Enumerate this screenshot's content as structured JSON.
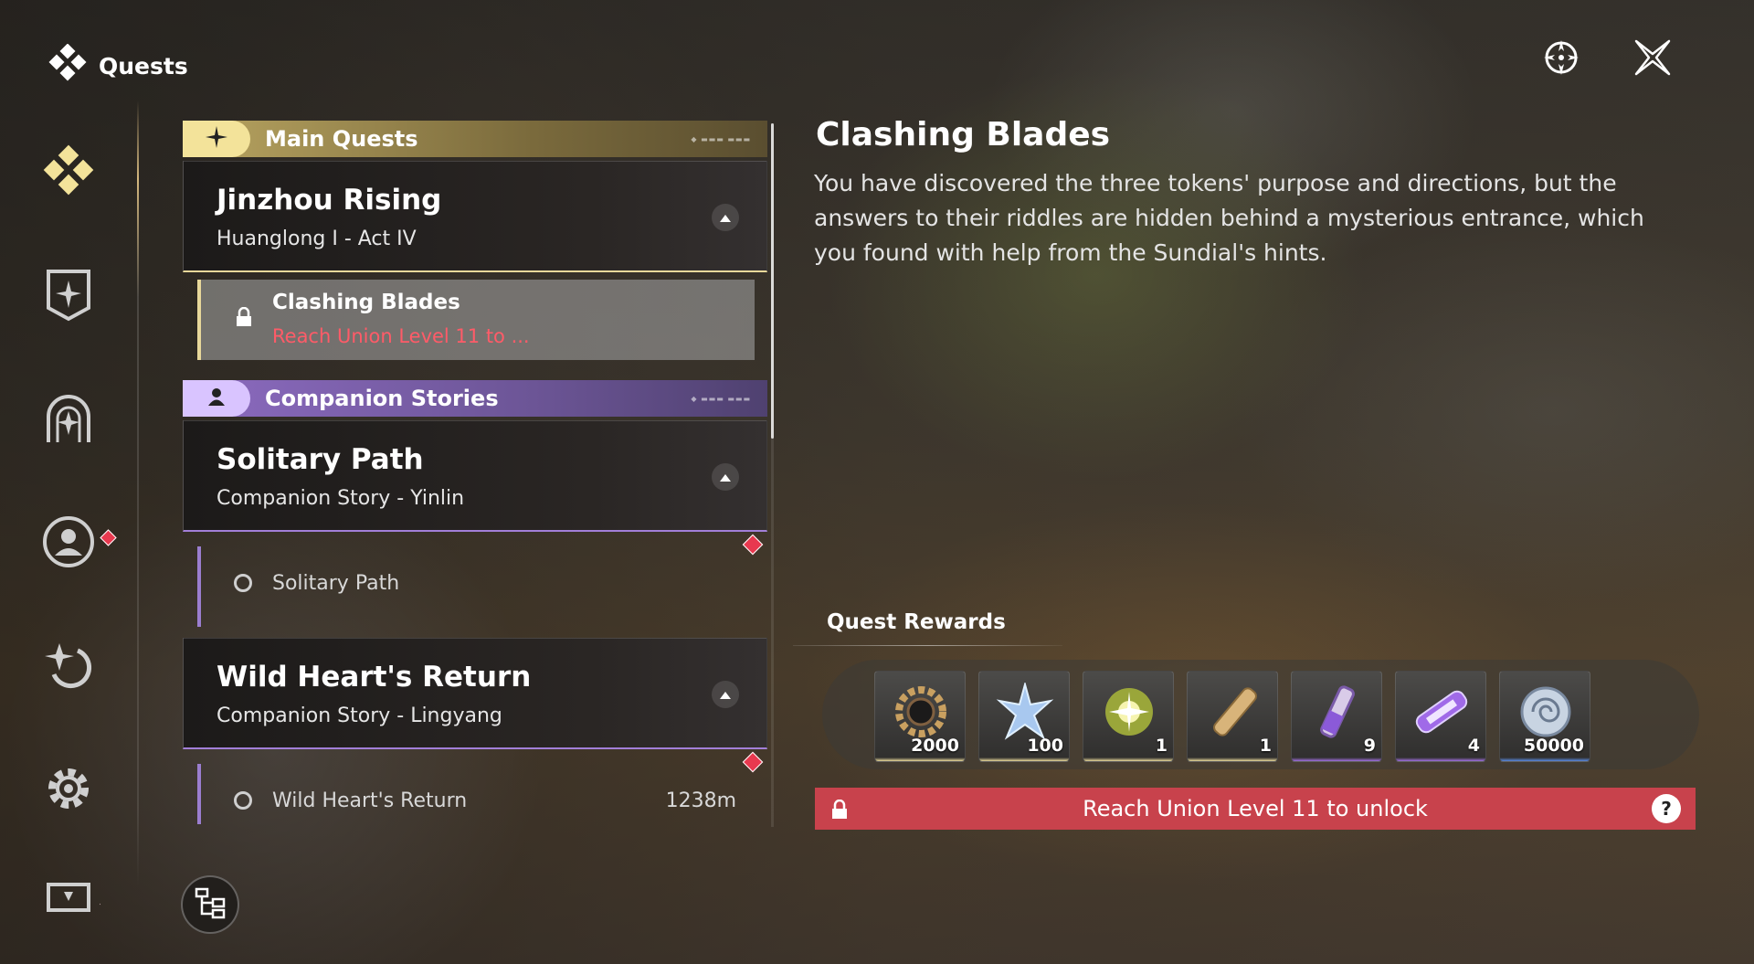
{
  "header": {
    "title": "Quests",
    "icons": {
      "brand": "quest-diamond-icon",
      "track": "crosshair-icon",
      "close": "close-icon"
    }
  },
  "sidebar": {
    "items": [
      {
        "icon": "quest-diamond-icon",
        "active": true
      },
      {
        "icon": "shield-star-icon",
        "active": false
      },
      {
        "icon": "arch-star-icon",
        "active": false
      },
      {
        "icon": "companion-face-icon",
        "active": false,
        "badge": true
      },
      {
        "icon": "star-refresh-icon",
        "active": false
      },
      {
        "icon": "gear-icon",
        "active": false
      },
      {
        "icon": "screen-icon",
        "active": false,
        "badge": true
      }
    ]
  },
  "quest_list": {
    "categories": [
      {
        "label": "Main Quests",
        "color": "#f3e39a",
        "quests": [
          {
            "title": "Jinzhou Rising",
            "subtitle": "Huanglong I - Act IV",
            "steps": [
              {
                "title": "Clashing Blades",
                "requirement": "Reach Union Level 11 to ...",
                "locked": true,
                "selected": true
              }
            ]
          }
        ]
      },
      {
        "label": "Companion Stories",
        "color": "#d9c4ff",
        "quests": [
          {
            "title": "Solitary Path",
            "subtitle": "Companion Story - Yinlin",
            "steps": [
              {
                "title": "Solitary Path",
                "distance": ""
              }
            ]
          },
          {
            "title": "Wild Heart's Return",
            "subtitle": "Companion Story - Lingyang",
            "steps": [
              {
                "title": "Wild Heart's Return",
                "distance": "1238m"
              }
            ]
          }
        ]
      }
    ]
  },
  "detail": {
    "title": "Clashing Blades",
    "description": "You have discovered the three tokens' purpose and directions, but the answers to their riddles are hidden behind a mysterious entrance, which you found with help from the Sundial's hints.",
    "rewards_label": "Quest Rewards",
    "rewards": [
      {
        "icon": "gear-ring-icon",
        "quantity": "2000",
        "rarity_color": "#e8d89a"
      },
      {
        "icon": "blue-star-crystal-icon",
        "quantity": "100",
        "rarity_color": "#e8d89a"
      },
      {
        "icon": "glowing-orb-icon",
        "quantity": "1",
        "rarity_color": "#e8d89a"
      },
      {
        "icon": "golden-scroll-icon",
        "quantity": "1",
        "rarity_color": "#e8d89a"
      },
      {
        "icon": "purple-vial-icon",
        "quantity": "9",
        "rarity_color": "#a070e0"
      },
      {
        "icon": "purple-capsule-icon",
        "quantity": "4",
        "rarity_color": "#a070e0"
      },
      {
        "icon": "shell-coin-icon",
        "quantity": "50000",
        "rarity_color": "#5a8ae0"
      }
    ],
    "unlock_text": "Reach Union Level 11 to unlock",
    "help_glyph": "?"
  },
  "colors": {
    "accent_gold": "#e8d89a",
    "accent_purple": "#a27fd8",
    "danger": "#c8424c",
    "badge_red": "#e8394f"
  }
}
